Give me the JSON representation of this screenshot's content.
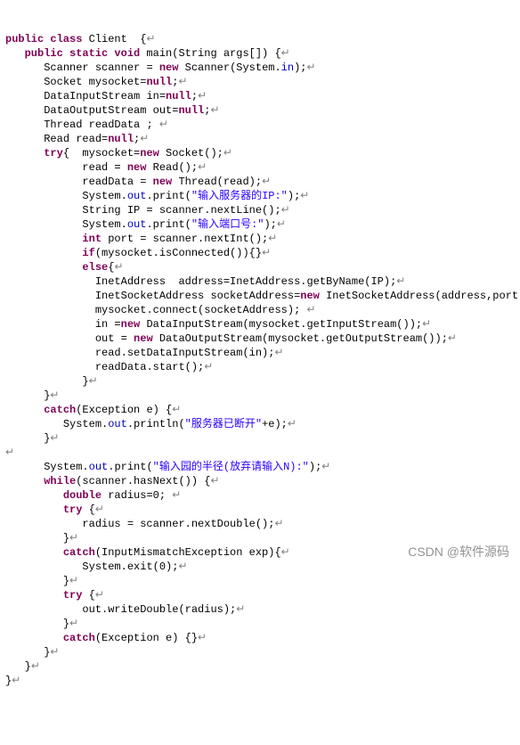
{
  "code": {
    "l1": {
      "a": "public class",
      "b": " Client  {",
      "ret": "↵"
    },
    "l2": {
      "a": "public static void",
      "b": " main(String args[]) {",
      "ret": "↵"
    },
    "l3": {
      "a": "Scanner scanner = ",
      "b": "new",
      "c": " Scanner(System.",
      "d": "in",
      "e": ");",
      "ret": "↵"
    },
    "l4": {
      "a": "Socket mysocket=",
      "b": "null",
      "c": ";",
      "ret": "↵"
    },
    "l5": {
      "a": "DataInputStream in=",
      "b": "null",
      "c": ";",
      "ret": "↵"
    },
    "l6": {
      "a": "DataOutputStream out=",
      "b": "null",
      "c": ";",
      "ret": "↵"
    },
    "l7": {
      "a": "Thread readData ; ",
      "ret": "↵"
    },
    "l8": {
      "a": "Read read=",
      "b": "null",
      "c": ";",
      "ret": "↵"
    },
    "l9": {
      "a": "try",
      "b": "{  mysocket=",
      "c": "new",
      "d": " Socket();",
      "ret": "↵"
    },
    "l10": {
      "a": "read = ",
      "b": "new",
      "c": " Read();",
      "ret": "↵"
    },
    "l11": {
      "a": "readData = ",
      "b": "new",
      "c": " Thread(read);",
      "ret": "↵"
    },
    "l12": {
      "a": "System.",
      "b": "out",
      "c": ".print(",
      "d": "\"输入服务器的IP:\"",
      "e": ");",
      "ret": "↵"
    },
    "l13": {
      "a": "String IP = scanner.nextLine();",
      "ret": "↵"
    },
    "l14": {
      "a": "System.",
      "b": "out",
      "c": ".print(",
      "d": "\"输入端口号:\"",
      "e": ");",
      "ret": "↵"
    },
    "l15": {
      "a": "int",
      "b": " port = scanner.nextInt();",
      "ret": "↵"
    },
    "l16": {
      "a": "if",
      "b": "(mysocket.isConnected()){}",
      "ret": "↵"
    },
    "l17": {
      "a": "else",
      "b": "{",
      "ret": "↵"
    },
    "l18": {
      "a": "InetAddress  address=InetAddress.getByName(IP);",
      "ret": "↵"
    },
    "l19": {
      "a": "InetSocketAddress socketAddress=",
      "b": "new",
      "c": " InetSocketAddress(address,port);",
      "ret": "↵"
    },
    "l20": {
      "a": "mysocket.connect(socketAddress); ",
      "ret": "↵"
    },
    "l21": {
      "a": "in =",
      "b": "new",
      "c": " DataInputStream(mysocket.getInputStream());",
      "ret": "↵"
    },
    "l22": {
      "a": "out = ",
      "b": "new",
      "c": " DataOutputStream(mysocket.getOutputStream());",
      "ret": "↵"
    },
    "l23": {
      "a": "read.setDataInputStream(in);",
      "ret": "↵"
    },
    "l24": {
      "a": "readData.start();",
      "ret": "↵"
    },
    "l25": {
      "a": "}",
      "ret": "↵"
    },
    "l26": {
      "a": "}",
      "ret": "↵"
    },
    "l27": {
      "a": "catch",
      "b": "(Exception e) {",
      "ret": "↵"
    },
    "l28": {
      "a": "System.",
      "b": "out",
      "c": ".println(",
      "d": "\"服务器已断开\"",
      "e": "+e);",
      "ret": "↵"
    },
    "l29": {
      "a": "}",
      "ret": "↵"
    },
    "l30": {
      "ret": "↵"
    },
    "l31": {
      "a": "System.",
      "b": "out",
      "c": ".print(",
      "d": "\"输入园的半径(放弃请输入N):\"",
      "e": ");",
      "ret": "↵"
    },
    "l32": {
      "a": "while",
      "b": "(scanner.hasNext()) {",
      "ret": "↵"
    },
    "l33": {
      "a": "double",
      "b": " radius=0; ",
      "ret": "↵"
    },
    "l34": {
      "a": "try",
      "b": " {",
      "ret": "↵"
    },
    "l35": {
      "a": "radius = scanner.nextDouble();",
      "ret": "↵"
    },
    "l36": {
      "a": "}",
      "ret": "↵"
    },
    "l37": {
      "a": "catch",
      "b": "(InputMismatchException exp){",
      "ret": "↵"
    },
    "l38": {
      "a": "System.exit(0);",
      "ret": "↵"
    },
    "l39": {
      "a": "}",
      "ret": "↵"
    },
    "l40": {
      "a": "try",
      "b": " {",
      "ret": "↵"
    },
    "l41": {
      "a": "out.writeDouble(radius);",
      "ret": "↵"
    },
    "l42": {
      "a": "}",
      "ret": "↵"
    },
    "l43": {
      "a": "catch",
      "b": "(Exception e) {}",
      "ret": "↵"
    },
    "l44": {
      "a": "}",
      "ret": "↵"
    },
    "l45": {
      "a": "}",
      "ret": "↵"
    },
    "l46": {
      "a": "}",
      "ret": "↵"
    }
  },
  "indent": {
    "i0": "",
    "i1": "   ",
    "i2": "      ",
    "i3": "         ",
    "i4": "            ",
    "i5": "              "
  },
  "watermark": "CSDN @软件源码"
}
